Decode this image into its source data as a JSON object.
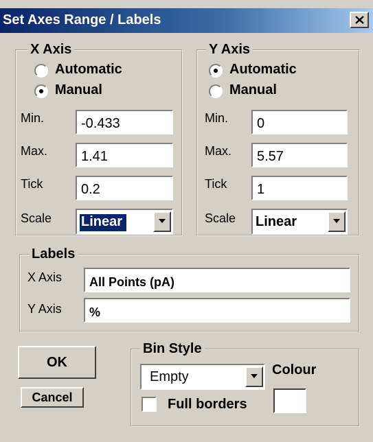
{
  "window": {
    "title": "Set Axes Range / Labels"
  },
  "x_axis": {
    "legend": "X Axis",
    "automatic_label": "Automatic",
    "manual_label": "Manual",
    "mode": "Manual",
    "min_label": "Min.",
    "min_value": "-0.433",
    "max_label": "Max.",
    "max_value": "1.41",
    "tick_label": "Tick",
    "tick_value": "0.2",
    "scale_label": "Scale",
    "scale_value": "Linear"
  },
  "y_axis": {
    "legend": "Y Axis",
    "automatic_label": "Automatic",
    "manual_label": "Manual",
    "mode": "Automatic",
    "min_label": "Min.",
    "min_value": "0",
    "max_label": "Max.",
    "max_value": "5.57",
    "tick_label": "Tick",
    "tick_value": "1",
    "scale_label": "Scale",
    "scale_value": "Linear"
  },
  "labels": {
    "legend": "Labels",
    "x_label": "X Axis",
    "x_value": "All Points (pA)",
    "y_label": "Y Axis",
    "y_value": "%"
  },
  "buttons": {
    "ok": "OK",
    "cancel": "Cancel"
  },
  "bin_style": {
    "legend": "Bin Style",
    "style_value": "Empty",
    "full_borders_label": "Full borders",
    "full_borders_checked": false,
    "colour_label": "Colour",
    "colour_value": "#ffffff"
  },
  "colors": {
    "face": "#d4d0c8",
    "title_start": "#0a246a",
    "title_end": "#a6caf0",
    "selection": "#0a246a"
  },
  "icons": {
    "close": "close-icon",
    "dropdown": "chevron-down-icon"
  }
}
